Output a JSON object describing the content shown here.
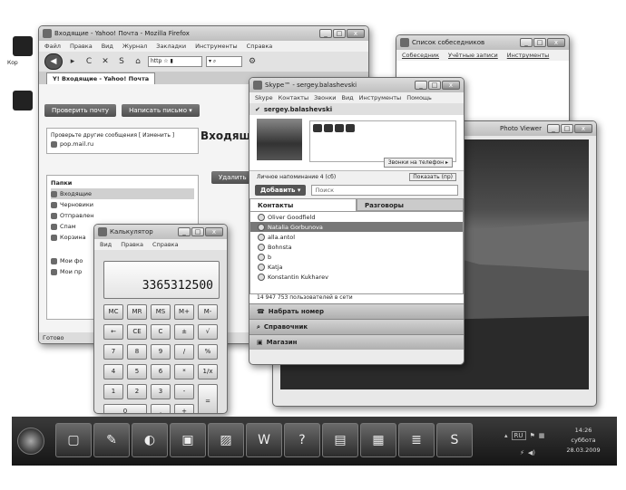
{
  "desktop": {
    "icon_label": "Кор"
  },
  "firefox": {
    "title": "Входящие - Yahoo! Почта - Mozilla Firefox",
    "menu": [
      "Файл",
      "Правка",
      "Вид",
      "Журнал",
      "Закладки",
      "Инструменты",
      "Справка"
    ],
    "tab_label": "Входящие - Yahoo! Почта",
    "logo": "Y!",
    "check_mail_btn": "Проверить почту",
    "compose_btn": "Написать письмо ▾",
    "other_mail_text": "Проверьте другие сообщения",
    "change_link": "[ Изменить ]",
    "account": "pop.mail.ru",
    "folders_header": "Папки",
    "folders": [
      "Входящие",
      "Черновики",
      "Отправлен",
      "Спам",
      "Корзина"
    ],
    "my_folders": [
      "Мои фо",
      "Мои пр"
    ],
    "main_title": "Входящ",
    "delete_btn": "Удалить",
    "status": "Готово"
  },
  "chat": {
    "title": "Список собеседников",
    "menu": [
      "Собеседник",
      "Учётные записи",
      "Инструменты"
    ]
  },
  "photo": {
    "title": "Photo Viewer"
  },
  "skype": {
    "title": "Skype™ - sergey.balashevski",
    "menu": [
      "Skype",
      "Контакты",
      "Звонки",
      "Вид",
      "Инструменты",
      "Помощь"
    ],
    "user": "sergey.balashevski",
    "phone_btn": "Звонки на телефон ▸",
    "show_btn": "Показать (пр)",
    "status_text": "Личное напоминание 4 (сб)",
    "add_btn": "Добавить ▾",
    "search_placeholder": "Поиск",
    "tabs": [
      "Контакты",
      "Разговоры"
    ],
    "contacts": [
      "Oliver Goodfield",
      "Natalia Gorbunova",
      "alla.antol",
      "Bohnsta",
      "b",
      "Katja",
      "Konstantin Kukharev"
    ],
    "count_text": "14 947 753 пользователей в сети",
    "bars": [
      "Набрать номер",
      "Справочник",
      "Магазин"
    ]
  },
  "calculator": {
    "title": "Калькулятор",
    "menu": [
      "Вид",
      "Правка",
      "Справка"
    ],
    "display": "3365312500",
    "keys": [
      "MC",
      "MR",
      "MS",
      "M+",
      "M-",
      "←",
      "CE",
      "C",
      "±",
      "√",
      "7",
      "8",
      "9",
      "/",
      "%",
      "4",
      "5",
      "6",
      "*",
      "1/x",
      "1",
      "2",
      "3",
      "-",
      "=",
      "0",
      ",",
      "+"
    ]
  },
  "taskbar": {
    "tray_lang": "RU",
    "time": "14:26",
    "day": "суббота",
    "date": "28.03.2009",
    "apps": [
      "windows-icon",
      "paint-icon",
      "firefox-icon",
      "floppy-icon",
      "chart-icon",
      "word-icon",
      "help-icon",
      "calculator-icon",
      "photo-icon",
      "list-icon",
      "skype-icon"
    ],
    "glyphs": [
      "▢",
      "✎",
      "◐",
      "▣",
      "▨",
      "W",
      "?",
      "▤",
      "▦",
      "≣",
      "S"
    ]
  }
}
